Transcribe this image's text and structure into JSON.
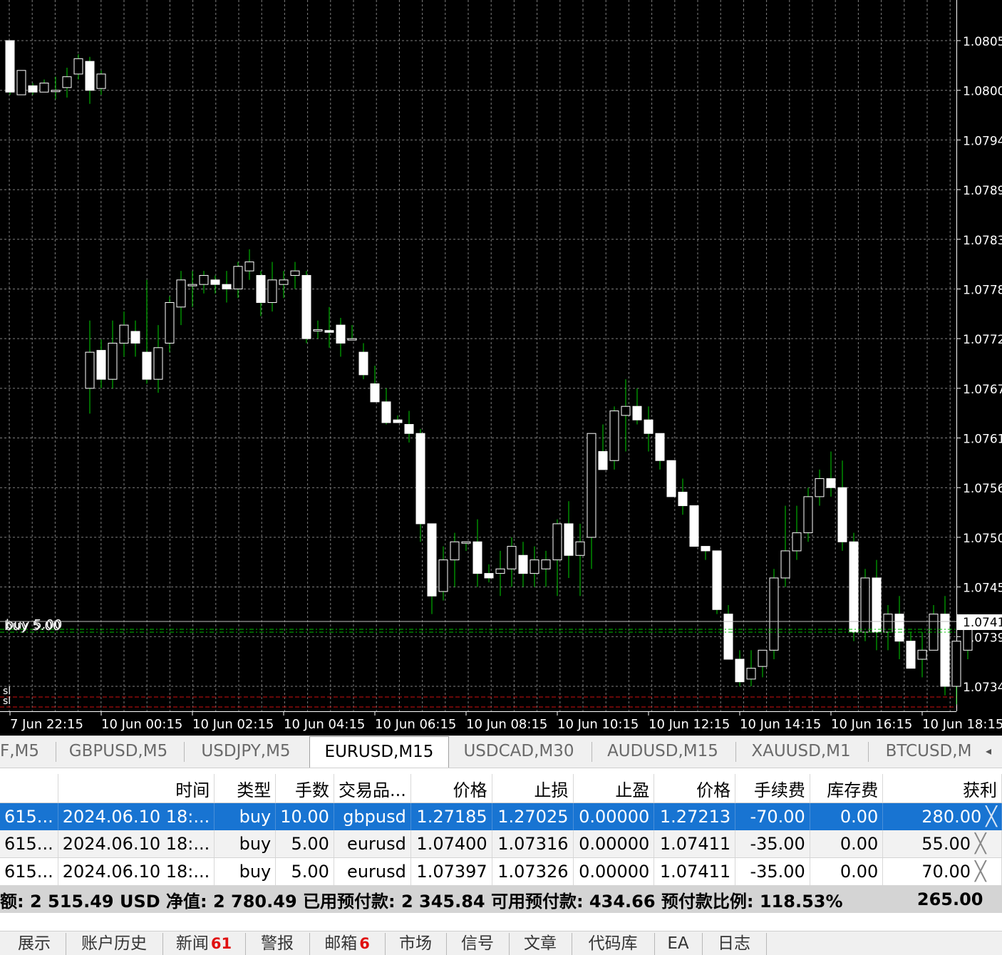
{
  "chart": {
    "symbol": "EURUSD",
    "timeframe": "M15",
    "background": "#000000",
    "bull_color": "#ffffff",
    "bear_color": "#000000",
    "wick_color": "#00d000",
    "grid_color": "#7f7f7f",
    "price_labels": [
      "1.0805",
      "1.0800",
      "1.0794",
      "1.0789",
      "1.0783",
      "1.0778",
      "1.0772",
      "1.0767",
      "1.0761",
      "1.0756",
      "1.0750",
      "1.0745",
      "1.0739",
      "1.0734"
    ],
    "time_labels": [
      "7 Jun 22:15",
      "10 Jun 00:15",
      "10 Jun 02:15",
      "10 Jun 04:15",
      "10 Jun 06:15",
      "10 Jun 08:15",
      "10 Jun 10:15",
      "10 Jun 12:15",
      "10 Jun 14:15",
      "10 Jun 16:15",
      "10 Jun 18:15"
    ],
    "current_price": "1.0741",
    "order_line_label": "buy 5.00",
    "order_line_label_2": "buy 5.00",
    "sl_label_1": "sl",
    "sl_label_2": "sl",
    "order_line_color": "#00c000",
    "sl_line_color": "#d01010"
  },
  "chart_data": {
    "type": "candlestick",
    "price_axis": [
      1.0733,
      1.0808
    ],
    "first_bar_time": "7 Jun 22:15",
    "interval": "M15",
    "session_1": [
      [
        1.08055,
        1.08055,
        1.07995,
        1.07998
      ],
      [
        1.07995,
        1.08022,
        1.08002,
        1.08022
      ],
      [
        1.08005,
        1.08008,
        1.07995,
        1.07998
      ],
      [
        1.07998,
        1.08012,
        1.07998,
        1.08008
      ],
      [
        1.08,
        1.08015,
        1.0799,
        1.08
      ],
      [
        1.08003,
        1.08025,
        1.07992,
        1.08015
      ],
      [
        1.08018,
        1.0804,
        1.08012,
        1.08035
      ],
      [
        1.08032,
        1.08037,
        1.07985,
        1.08
      ],
      [
        1.08002,
        1.08022,
        1.07995,
        1.08018
      ]
    ],
    "session_2": [
      [
        1.0767,
        1.07745,
        1.07642,
        1.0771
      ],
      [
        1.07712,
        1.07724,
        1.0767,
        1.0768
      ],
      [
        1.0768,
        1.07745,
        1.0767,
        1.0772
      ],
      [
        1.0772,
        1.07755,
        1.07705,
        1.0774
      ],
      [
        1.07733,
        1.07745,
        1.07705,
        1.0772
      ],
      [
        1.0771,
        1.0779,
        1.07675,
        1.0768
      ],
      [
        1.0768,
        1.0774,
        1.07665,
        1.07715
      ],
      [
        1.0772,
        1.07772,
        1.0771,
        1.07765
      ],
      [
        1.0776,
        1.078,
        1.0774,
        1.0779
      ],
      [
        1.07785,
        1.078,
        1.0776,
        1.07785
      ],
      [
        1.07785,
        1.078,
        1.07775,
        1.07795
      ],
      [
        1.0779,
        1.07795,
        1.07775,
        1.07785
      ],
      [
        1.07785,
        1.078,
        1.07765,
        1.0778
      ],
      [
        1.0778,
        1.0781,
        1.0777,
        1.07805
      ],
      [
        1.078,
        1.07824,
        1.0779,
        1.0781
      ],
      [
        1.07795,
        1.078,
        1.0775,
        1.07765
      ],
      [
        1.07765,
        1.0781,
        1.07755,
        1.0779
      ],
      [
        1.07785,
        1.078,
        1.0777,
        1.0779
      ],
      [
        1.07795,
        1.0781,
        1.0778,
        1.078
      ],
      [
        1.07795,
        1.078,
        1.0772,
        1.07725
      ],
      [
        1.07735,
        1.07745,
        1.07725,
        1.07735
      ],
      [
        1.07734,
        1.0776,
        1.07715,
        1.07732
      ],
      [
        1.0774,
        1.07748,
        1.07705,
        1.0772
      ],
      [
        1.07725,
        1.0774,
        1.07725,
        1.07725
      ],
      [
        1.0771,
        1.0772,
        1.0768,
        1.07685
      ],
      [
        1.07675,
        1.07695,
        1.0766,
        1.07655
      ],
      [
        1.07655,
        1.0767,
        1.0763,
        1.07632
      ],
      [
        1.07635,
        1.0764,
        1.07632,
        1.07632
      ],
      [
        1.0763,
        1.07645,
        1.0761,
        1.0762
      ],
      [
        1.0762,
        1.07625,
        1.075,
        1.0752
      ],
      [
        1.0752,
        1.0752,
        1.0742,
        1.0744
      ],
      [
        1.07445,
        1.07495,
        1.07435,
        1.0748
      ],
      [
        1.0748,
        1.0751,
        1.0745,
        1.075
      ],
      [
        1.075,
        1.075,
        1.0749,
        1.075
      ],
      [
        1.075,
        1.07525,
        1.0745,
        1.07465
      ],
      [
        1.07465,
        1.07475,
        1.07455,
        1.0746
      ],
      [
        1.07465,
        1.0749,
        1.0744,
        1.0747
      ],
      [
        1.0747,
        1.07505,
        1.0745,
        1.07495
      ],
      [
        1.07485,
        1.075,
        1.0745,
        1.07465
      ],
      [
        1.07465,
        1.07495,
        1.0745,
        1.0748
      ],
      [
        1.0747,
        1.0749,
        1.0745,
        1.0748
      ],
      [
        1.0748,
        1.07525,
        1.0744,
        1.0752
      ],
      [
        1.0752,
        1.07545,
        1.0746,
        1.07485
      ],
      [
        1.07485,
        1.0752,
        1.0744,
        1.075
      ],
      [
        1.07505,
        1.0757,
        1.0747,
        1.0762
      ],
      [
        1.076,
        1.0763,
        1.0758,
        1.0758
      ],
      [
        1.0759,
        1.0765,
        1.0758,
        1.07645
      ],
      [
        1.0764,
        1.0768,
        1.076,
        1.0765
      ],
      [
        1.0765,
        1.0767,
        1.0763,
        1.07635
      ],
      [
        1.07635,
        1.0765,
        1.076,
        1.0762
      ],
      [
        1.0762,
        1.0762,
        1.0758,
        1.0759
      ],
      [
        1.0759,
        1.0759,
        1.0755,
        1.0755
      ],
      [
        1.07555,
        1.0757,
        1.0753,
        1.0754
      ],
      [
        1.0754,
        1.0754,
        1.07495,
        1.07495
      ],
      [
        1.07495,
        1.07495,
        1.0748,
        1.0749
      ],
      [
        1.0749,
        1.0749,
        1.0742,
        1.07425
      ],
      [
        1.0742,
        1.0743,
        1.0737,
        1.0737
      ],
      [
        1.0737,
        1.0738,
        1.0734,
        1.07345
      ],
      [
        1.07348,
        1.0738,
        1.0734,
        1.0736
      ],
      [
        1.07362,
        1.0738,
        1.0735,
        1.0738
      ],
      [
        1.0738,
        1.0747,
        1.0737,
        1.0746
      ],
      [
        1.0746,
        1.0754,
        1.0745,
        1.0749
      ],
      [
        1.0749,
        1.0754,
        1.0748,
        1.0751
      ],
      [
        1.0751,
        1.0756,
        1.075,
        1.0755
      ],
      [
        1.0755,
        1.0758,
        1.0754,
        1.0757
      ],
      [
        1.0757,
        1.076,
        1.0755,
        1.0756
      ],
      [
        1.0756,
        1.0759,
        1.0749,
        1.075
      ],
      [
        1.075,
        1.0751,
        1.0739,
        1.074
      ],
      [
        1.074,
        1.0747,
        1.0739,
        1.0746
      ],
      [
        1.0746,
        1.0748,
        1.0738,
        1.074
      ],
      [
        1.074,
        1.0743,
        1.0738,
        1.0742
      ],
      [
        1.0742,
        1.0744,
        1.0737,
        1.0739
      ],
      [
        1.0739,
        1.074,
        1.0736,
        1.0736
      ],
      [
        1.0737,
        1.074,
        1.0735,
        1.0738
      ],
      [
        1.0738,
        1.0743,
        1.0738,
        1.0742
      ],
      [
        1.0742,
        1.0744,
        1.0733,
        1.0734
      ],
      [
        1.0734,
        1.0739,
        1.0732,
        1.0739
      ],
      [
        1.0738,
        1.0742,
        1.0737,
        1.0741
      ]
    ]
  },
  "tabs": [
    "F,M5",
    "GBPUSD,M5",
    "USDJPY,M5",
    "EURUSD,M15",
    "USDCAD,M30",
    "AUDUSD,M15",
    "XAUUSD,M1",
    "BTCUSD,M"
  ],
  "active_tab_index": 3,
  "tab_scroll_arrow": "◂",
  "table": {
    "headers": [
      "",
      "时间",
      "类型",
      "手数",
      "交易品...",
      "价格",
      "止损",
      "止盈",
      "价格",
      "手续费",
      "库存费",
      "获利"
    ],
    "rows": [
      [
        "615...",
        "2024.06.10 18:...",
        "buy",
        "10.00",
        "gbpusd",
        "1.27185",
        "1.27025",
        "0.00000",
        "1.27213",
        "-70.00",
        "0.00",
        "280.00"
      ],
      [
        "615...",
        "2024.06.10 18:...",
        "buy",
        "5.00",
        "eurusd",
        "1.07400",
        "1.07316",
        "0.00000",
        "1.07411",
        "-35.00",
        "0.00",
        "55.00"
      ],
      [
        "615...",
        "2024.06.10 18:...",
        "buy",
        "5.00",
        "eurusd",
        "1.07397",
        "1.07326",
        "0.00000",
        "1.07411",
        "-35.00",
        "0.00",
        "70.00"
      ]
    ],
    "balance_text": "额: 2 515.49 USD  净值: 2 780.49  已用预付款: 2 345.84  可用预付款: 434.66  预付款比例: 118.53%",
    "balance_profit": "265.00"
  },
  "bottom_tabs": [
    {
      "label": "展示",
      "badge": ""
    },
    {
      "label": "账户历史",
      "badge": ""
    },
    {
      "label": "新闻",
      "badge": "61"
    },
    {
      "label": "警报",
      "badge": ""
    },
    {
      "label": "邮箱",
      "badge": "6"
    },
    {
      "label": "市场",
      "badge": ""
    },
    {
      "label": "信号",
      "badge": ""
    },
    {
      "label": "文章",
      "badge": ""
    },
    {
      "label": "代码库",
      "badge": ""
    },
    {
      "label": "EA",
      "badge": ""
    },
    {
      "label": "日志",
      "badge": ""
    }
  ]
}
